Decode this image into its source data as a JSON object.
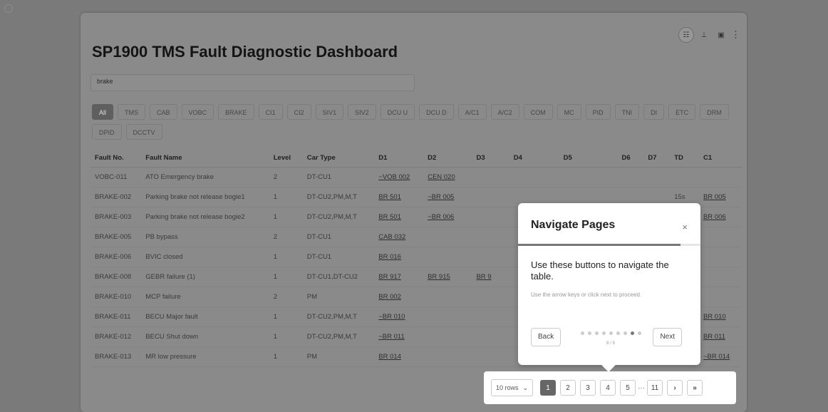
{
  "title": "SP1900 TMS Fault Diagnostic Dashboard",
  "search": {
    "value": "brake"
  },
  "filters": [
    "All",
    "TMS",
    "CAB",
    "VOBC",
    "BRAKE",
    "CI1",
    "CI2",
    "SIV1",
    "SIV2",
    "DCU U",
    "DCU D",
    "A/C1",
    "A/C2",
    "COM",
    "MC",
    "PID",
    "TNI",
    "DI",
    "ETC",
    "DRM",
    "DPID",
    "DCCTV"
  ],
  "active_filter": "All",
  "table": {
    "headers": [
      "Fault No.",
      "Fault Name",
      "Level",
      "Car Type",
      "D1",
      "D2",
      "D3",
      "D4",
      "D5",
      "D6",
      "D7",
      "TD",
      "C1"
    ],
    "rows": [
      [
        "VOBC-011",
        "ATO Emergency brake",
        "2",
        "DT-CU1",
        "~VOB 002",
        "CEN 020",
        "",
        "",
        "",
        "",
        "",
        "",
        ""
      ],
      [
        "BRAKE-002",
        "Parking brake not release bogie1",
        "1",
        "DT-CU2,PM,M,T",
        "BR 501",
        "~BR 005",
        "",
        "",
        "",
        "",
        "",
        "15s",
        "BR 005"
      ],
      [
        "BRAKE-003",
        "Parking brake not release bogie2",
        "1",
        "DT-CU2,PM,M,T",
        "BR 501",
        "~BR 006",
        "",
        "",
        "",
        "",
        "",
        "",
        "BR 006"
      ],
      [
        "BRAKE-005",
        "PB bypass",
        "2",
        "DT-CU1",
        "CAB 032",
        "",
        "",
        "",
        "",
        "",
        "",
        "",
        ""
      ],
      [
        "BRAKE-006",
        "BVIC closed",
        "1",
        "DT-CU1",
        "BR 016",
        "",
        "",
        "",
        "",
        "",
        "",
        "",
        ""
      ],
      [
        "BRAKE-008",
        "GEBR failure (1)",
        "1",
        "DT-CU1,DT-CU2",
        "BR 917",
        "BR 915",
        "BR 9",
        "",
        "",
        "",
        "",
        "",
        ""
      ],
      [
        "BRAKE-010",
        "MCP failure",
        "2",
        "PM",
        "BR 002",
        "",
        "",
        "",
        "",
        "",
        "",
        "",
        ""
      ],
      [
        "BRAKE-011",
        "BECU Major fault",
        "1",
        "DT-CU2,PM,M,T",
        "~BR 010",
        "",
        "",
        "",
        "",
        "",
        "",
        "",
        "BR 010"
      ],
      [
        "BRAKE-012",
        "BECU Shut down",
        "1",
        "DT-CU2,PM,M,T",
        "~BR 011",
        "",
        "",
        "",
        "",
        "",
        "",
        "",
        "BR 011"
      ],
      [
        "BRAKE-013",
        "MR low pressure",
        "1",
        "PM",
        "BR 014",
        "",
        "",
        "",
        "",
        "",
        "",
        "",
        "~BR 014"
      ]
    ]
  },
  "pagination": {
    "rows_label": "10 rows",
    "pages": [
      "1",
      "2",
      "3",
      "4",
      "5"
    ],
    "ellipsis": "···",
    "last_page": "11",
    "next": "›",
    "last": "»",
    "current": "1"
  },
  "tour": {
    "title": "Navigate Pages",
    "close": "×",
    "body": "Use these buttons to navigate the table.",
    "hint": "Use the arrow keys or click next to proceed.",
    "back": "Back",
    "next": "Next",
    "step": "8 / 9",
    "progress": 0.89
  },
  "toolbar": {
    "icons": [
      "table-icon",
      "chart-icon",
      "save-icon",
      "kebab-menu-icon"
    ]
  }
}
